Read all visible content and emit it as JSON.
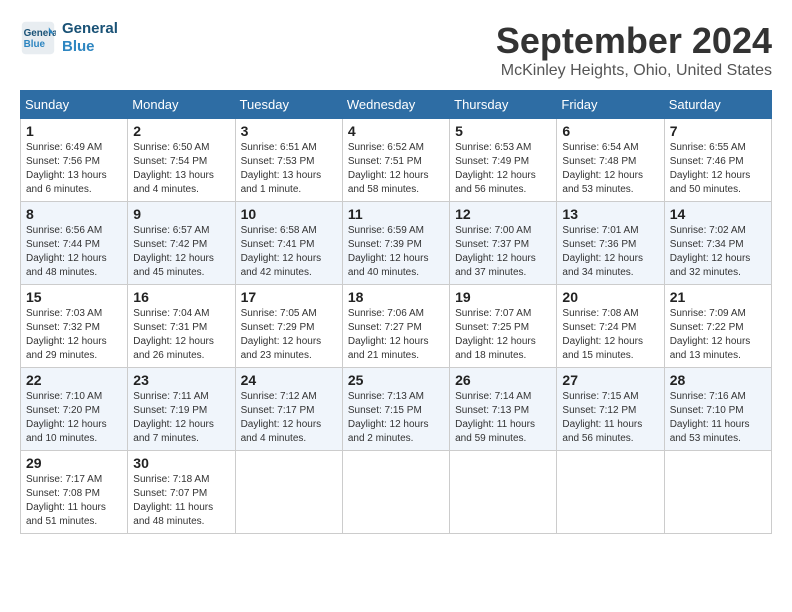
{
  "header": {
    "logo_line1": "General",
    "logo_line2": "Blue",
    "month": "September 2024",
    "location": "McKinley Heights, Ohio, United States"
  },
  "columns": [
    "Sunday",
    "Monday",
    "Tuesday",
    "Wednesday",
    "Thursday",
    "Friday",
    "Saturday"
  ],
  "weeks": [
    [
      {
        "day": "1",
        "info": "Sunrise: 6:49 AM\nSunset: 7:56 PM\nDaylight: 13 hours\nand 6 minutes."
      },
      {
        "day": "2",
        "info": "Sunrise: 6:50 AM\nSunset: 7:54 PM\nDaylight: 13 hours\nand 4 minutes."
      },
      {
        "day": "3",
        "info": "Sunrise: 6:51 AM\nSunset: 7:53 PM\nDaylight: 13 hours\nand 1 minute."
      },
      {
        "day": "4",
        "info": "Sunrise: 6:52 AM\nSunset: 7:51 PM\nDaylight: 12 hours\nand 58 minutes."
      },
      {
        "day": "5",
        "info": "Sunrise: 6:53 AM\nSunset: 7:49 PM\nDaylight: 12 hours\nand 56 minutes."
      },
      {
        "day": "6",
        "info": "Sunrise: 6:54 AM\nSunset: 7:48 PM\nDaylight: 12 hours\nand 53 minutes."
      },
      {
        "day": "7",
        "info": "Sunrise: 6:55 AM\nSunset: 7:46 PM\nDaylight: 12 hours\nand 50 minutes."
      }
    ],
    [
      {
        "day": "8",
        "info": "Sunrise: 6:56 AM\nSunset: 7:44 PM\nDaylight: 12 hours\nand 48 minutes."
      },
      {
        "day": "9",
        "info": "Sunrise: 6:57 AM\nSunset: 7:42 PM\nDaylight: 12 hours\nand 45 minutes."
      },
      {
        "day": "10",
        "info": "Sunrise: 6:58 AM\nSunset: 7:41 PM\nDaylight: 12 hours\nand 42 minutes."
      },
      {
        "day": "11",
        "info": "Sunrise: 6:59 AM\nSunset: 7:39 PM\nDaylight: 12 hours\nand 40 minutes."
      },
      {
        "day": "12",
        "info": "Sunrise: 7:00 AM\nSunset: 7:37 PM\nDaylight: 12 hours\nand 37 minutes."
      },
      {
        "day": "13",
        "info": "Sunrise: 7:01 AM\nSunset: 7:36 PM\nDaylight: 12 hours\nand 34 minutes."
      },
      {
        "day": "14",
        "info": "Sunrise: 7:02 AM\nSunset: 7:34 PM\nDaylight: 12 hours\nand 32 minutes."
      }
    ],
    [
      {
        "day": "15",
        "info": "Sunrise: 7:03 AM\nSunset: 7:32 PM\nDaylight: 12 hours\nand 29 minutes."
      },
      {
        "day": "16",
        "info": "Sunrise: 7:04 AM\nSunset: 7:31 PM\nDaylight: 12 hours\nand 26 minutes."
      },
      {
        "day": "17",
        "info": "Sunrise: 7:05 AM\nSunset: 7:29 PM\nDaylight: 12 hours\nand 23 minutes."
      },
      {
        "day": "18",
        "info": "Sunrise: 7:06 AM\nSunset: 7:27 PM\nDaylight: 12 hours\nand 21 minutes."
      },
      {
        "day": "19",
        "info": "Sunrise: 7:07 AM\nSunset: 7:25 PM\nDaylight: 12 hours\nand 18 minutes."
      },
      {
        "day": "20",
        "info": "Sunrise: 7:08 AM\nSunset: 7:24 PM\nDaylight: 12 hours\nand 15 minutes."
      },
      {
        "day": "21",
        "info": "Sunrise: 7:09 AM\nSunset: 7:22 PM\nDaylight: 12 hours\nand 13 minutes."
      }
    ],
    [
      {
        "day": "22",
        "info": "Sunrise: 7:10 AM\nSunset: 7:20 PM\nDaylight: 12 hours\nand 10 minutes."
      },
      {
        "day": "23",
        "info": "Sunrise: 7:11 AM\nSunset: 7:19 PM\nDaylight: 12 hours\nand 7 minutes."
      },
      {
        "day": "24",
        "info": "Sunrise: 7:12 AM\nSunset: 7:17 PM\nDaylight: 12 hours\nand 4 minutes."
      },
      {
        "day": "25",
        "info": "Sunrise: 7:13 AM\nSunset: 7:15 PM\nDaylight: 12 hours\nand 2 minutes."
      },
      {
        "day": "26",
        "info": "Sunrise: 7:14 AM\nSunset: 7:13 PM\nDaylight: 11 hours\nand 59 minutes."
      },
      {
        "day": "27",
        "info": "Sunrise: 7:15 AM\nSunset: 7:12 PM\nDaylight: 11 hours\nand 56 minutes."
      },
      {
        "day": "28",
        "info": "Sunrise: 7:16 AM\nSunset: 7:10 PM\nDaylight: 11 hours\nand 53 minutes."
      }
    ],
    [
      {
        "day": "29",
        "info": "Sunrise: 7:17 AM\nSunset: 7:08 PM\nDaylight: 11 hours\nand 51 minutes."
      },
      {
        "day": "30",
        "info": "Sunrise: 7:18 AM\nSunset: 7:07 PM\nDaylight: 11 hours\nand 48 minutes."
      },
      {
        "day": "",
        "info": ""
      },
      {
        "day": "",
        "info": ""
      },
      {
        "day": "",
        "info": ""
      },
      {
        "day": "",
        "info": ""
      },
      {
        "day": "",
        "info": ""
      }
    ]
  ]
}
